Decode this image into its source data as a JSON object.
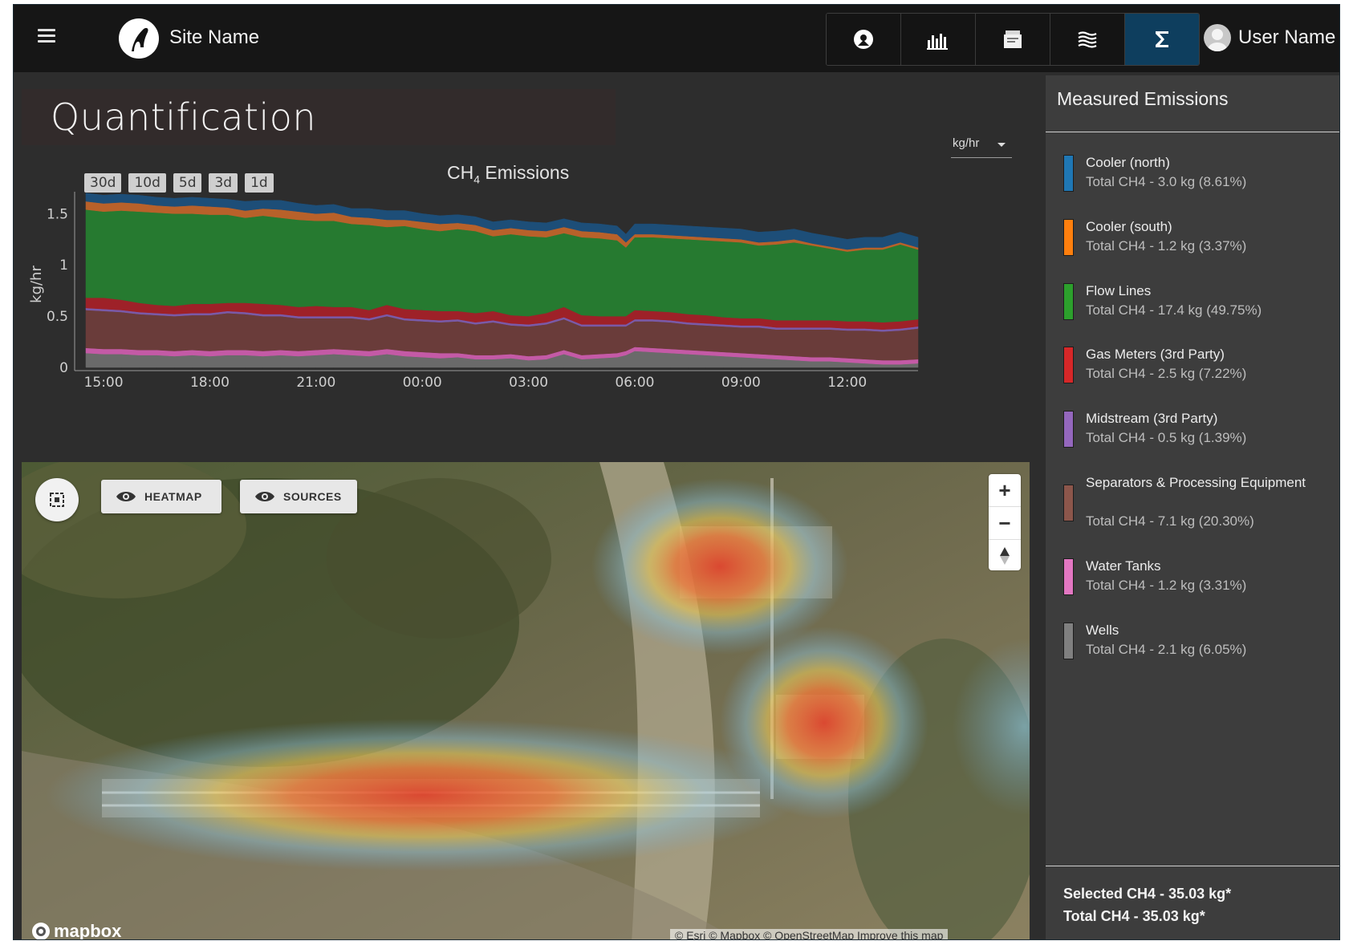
{
  "header": {
    "site_name": "Site Name",
    "user_name": "User Name",
    "nav_icons": [
      "map-pin-icon",
      "bar-chart-icon",
      "document-icon",
      "layers-icon",
      "sigma-icon"
    ],
    "active_nav": "sigma-icon",
    "colors": {
      "bar": "#161616",
      "active": "#0e3e5e"
    }
  },
  "page": {
    "title": "Quantification",
    "unit_select": "kg/hr",
    "range_buttons": [
      "30d",
      "10d",
      "5d",
      "3d",
      "1d"
    ]
  },
  "chart_data": {
    "type": "area",
    "stacked": true,
    "title": "CH4 Emissions",
    "title_sub": "4",
    "ylabel": "kg/hr",
    "xlabel": "",
    "ylim": [
      0,
      1.62
    ],
    "yticks": [
      0,
      0.5,
      1,
      1.5
    ],
    "ytick_labels": [
      "0",
      "0.5",
      "1",
      "1.5"
    ],
    "xticks": [
      15.0,
      18.0,
      21.0,
      24.0,
      27.0,
      30.0,
      33.0,
      36.0
    ],
    "xtick_labels": [
      "15:00",
      "18:00",
      "21:00",
      "00:00",
      "03:00",
      "06:00",
      "09:00",
      "12:00"
    ],
    "xlim": [
      14.5,
      38.0
    ],
    "x": [
      14.5,
      15,
      15.5,
      16,
      16.5,
      17,
      17.5,
      18,
      18.5,
      19,
      19.5,
      20,
      20.5,
      21,
      21.5,
      22,
      22.5,
      23,
      23.5,
      24,
      24.5,
      25,
      25.5,
      26,
      26.5,
      27,
      27.5,
      28,
      28.5,
      29,
      29.5,
      29.75,
      30,
      30.5,
      31,
      31.5,
      32,
      32.5,
      33,
      33.5,
      34,
      34.5,
      35,
      35.5,
      36,
      36.5,
      37,
      37.5,
      38
    ],
    "series": [
      {
        "name": "Wells",
        "color": "#6a6a6a",
        "values": [
          0.14,
          0.13,
          0.13,
          0.12,
          0.12,
          0.11,
          0.12,
          0.11,
          0.12,
          0.12,
          0.11,
          0.12,
          0.11,
          0.12,
          0.13,
          0.12,
          0.11,
          0.13,
          0.11,
          0.1,
          0.09,
          0.1,
          0.08,
          0.08,
          0.09,
          0.07,
          0.08,
          0.13,
          0.08,
          0.09,
          0.1,
          0.12,
          0.16,
          0.15,
          0.14,
          0.13,
          0.12,
          0.11,
          0.1,
          0.09,
          0.08,
          0.07,
          0.06,
          0.06,
          0.05,
          0.04,
          0.03,
          0.03,
          0.04
        ]
      },
      {
        "name": "Water Tanks",
        "color": "#c45aa6",
        "values": [
          0.05,
          0.05,
          0.05,
          0.05,
          0.05,
          0.05,
          0.05,
          0.05,
          0.05,
          0.05,
          0.05,
          0.05,
          0.05,
          0.05,
          0.05,
          0.05,
          0.05,
          0.05,
          0.05,
          0.05,
          0.05,
          0.04,
          0.04,
          0.04,
          0.04,
          0.04,
          0.04,
          0.04,
          0.04,
          0.04,
          0.04,
          0.04,
          0.04,
          0.04,
          0.04,
          0.04,
          0.04,
          0.04,
          0.04,
          0.04,
          0.04,
          0.04,
          0.04,
          0.04,
          0.04,
          0.04,
          0.04,
          0.04,
          0.04
        ]
      },
      {
        "name": "Separators & Processing Equipment",
        "color": "#6a3c3a",
        "values": [
          0.37,
          0.37,
          0.36,
          0.35,
          0.34,
          0.34,
          0.34,
          0.35,
          0.36,
          0.35,
          0.34,
          0.33,
          0.32,
          0.31,
          0.3,
          0.31,
          0.3,
          0.32,
          0.3,
          0.3,
          0.3,
          0.31,
          0.3,
          0.32,
          0.28,
          0.29,
          0.3,
          0.3,
          0.28,
          0.27,
          0.26,
          0.24,
          0.25,
          0.26,
          0.26,
          0.25,
          0.25,
          0.25,
          0.25,
          0.26,
          0.25,
          0.26,
          0.27,
          0.27,
          0.27,
          0.28,
          0.28,
          0.29,
          0.3
        ]
      },
      {
        "name": "Midstream (3rd Party)",
        "color": "#7a5aa8",
        "values": [
          0.02,
          0.02,
          0.02,
          0.02,
          0.02,
          0.02,
          0.02,
          0.02,
          0.02,
          0.02,
          0.02,
          0.02,
          0.02,
          0.02,
          0.02,
          0.02,
          0.02,
          0.02,
          0.02,
          0.02,
          0.02,
          0.02,
          0.02,
          0.02,
          0.02,
          0.02,
          0.02,
          0.02,
          0.02,
          0.02,
          0.02,
          0.02,
          0.02,
          0.02,
          0.02,
          0.02,
          0.02,
          0.02,
          0.02,
          0.02,
          0.02,
          0.02,
          0.02,
          0.02,
          0.02,
          0.02,
          0.02,
          0.02,
          0.02
        ]
      },
      {
        "name": "Gas Meters (3rd Party)",
        "color": "#9e2128",
        "values": [
          0.1,
          0.11,
          0.1,
          0.09,
          0.08,
          0.08,
          0.09,
          0.09,
          0.08,
          0.09,
          0.1,
          0.09,
          0.09,
          0.1,
          0.09,
          0.09,
          0.08,
          0.09,
          0.09,
          0.09,
          0.09,
          0.08,
          0.09,
          0.09,
          0.08,
          0.08,
          0.09,
          0.1,
          0.09,
          0.08,
          0.08,
          0.08,
          0.09,
          0.08,
          0.08,
          0.08,
          0.08,
          0.07,
          0.07,
          0.07,
          0.07,
          0.07,
          0.07,
          0.07,
          0.07,
          0.07,
          0.07,
          0.07,
          0.07
        ]
      },
      {
        "name": "Flow Lines",
        "color": "#267a30",
        "values": [
          0.86,
          0.84,
          0.87,
          0.89,
          0.9,
          0.9,
          0.88,
          0.87,
          0.86,
          0.83,
          0.86,
          0.85,
          0.85,
          0.83,
          0.84,
          0.81,
          0.83,
          0.76,
          0.81,
          0.79,
          0.78,
          0.8,
          0.8,
          0.73,
          0.79,
          0.78,
          0.74,
          0.72,
          0.76,
          0.76,
          0.74,
          0.67,
          0.71,
          0.72,
          0.72,
          0.73,
          0.73,
          0.74,
          0.74,
          0.71,
          0.74,
          0.76,
          0.73,
          0.7,
          0.68,
          0.7,
          0.71,
          0.75,
          0.68
        ]
      },
      {
        "name": "Cooler (south)",
        "color": "#b8612a",
        "values": [
          0.08,
          0.08,
          0.08,
          0.08,
          0.07,
          0.07,
          0.08,
          0.08,
          0.07,
          0.07,
          0.07,
          0.08,
          0.08,
          0.07,
          0.08,
          0.07,
          0.07,
          0.07,
          0.06,
          0.07,
          0.07,
          0.06,
          0.06,
          0.06,
          0.06,
          0.06,
          0.06,
          0.06,
          0.06,
          0.06,
          0.06,
          0.05,
          0.03,
          0.03,
          0.03,
          0.03,
          0.03,
          0.03,
          0.03,
          0.03,
          0.03,
          0.03,
          0.02,
          0.02,
          0.02,
          0.02,
          0.02,
          0.02,
          0.02
        ]
      },
      {
        "name": "Cooler (north)",
        "color": "#1d4e78",
        "values": [
          0.08,
          0.08,
          0.08,
          0.08,
          0.08,
          0.08,
          0.08,
          0.08,
          0.08,
          0.09,
          0.08,
          0.09,
          0.08,
          0.08,
          0.08,
          0.08,
          0.09,
          0.09,
          0.09,
          0.08,
          0.08,
          0.08,
          0.08,
          0.08,
          0.08,
          0.08,
          0.08,
          0.08,
          0.08,
          0.08,
          0.08,
          0.08,
          0.1,
          0.1,
          0.1,
          0.1,
          0.1,
          0.1,
          0.1,
          0.1,
          0.1,
          0.1,
          0.1,
          0.1,
          0.1,
          0.1,
          0.1,
          0.1,
          0.1
        ]
      }
    ]
  },
  "map": {
    "heatmap_label": "HEATMAP",
    "sources_label": "SOURCES",
    "zoom_in": "+",
    "zoom_out": "−",
    "mapbox_logo": "mapbox",
    "attribution": "© Esri  © Mapbox © OpenStreetMap  Improve this map"
  },
  "panel": {
    "title": "Measured Emissions",
    "items": [
      {
        "name": "Cooler (north)",
        "total": "Total CH4 - 3.0 kg (8.61%)",
        "color": "#1f77b4"
      },
      {
        "name": "Cooler (south)",
        "total": "Total CH4 - 1.2 kg (3.37%)",
        "color": "#ff7f0e"
      },
      {
        "name": "Flow Lines",
        "total": "Total CH4 - 17.4 kg (49.75%)",
        "color": "#2ca02c"
      },
      {
        "name": "Gas Meters (3rd Party)",
        "total": "Total CH4 - 2.5 kg (7.22%)",
        "color": "#d62728"
      },
      {
        "name": "Midstream (3rd Party)",
        "total": "Total CH4 - 0.5 kg (1.39%)",
        "color": "#9467bd"
      },
      {
        "name": "Separators & Processing Equipment",
        "total": "Total CH4 - 7.1 kg (20.30%)",
        "color": "#8c564b"
      },
      {
        "name": "Water Tanks",
        "total": "Total CH4 - 1.2 kg (3.31%)",
        "color": "#e377c2"
      },
      {
        "name": "Wells",
        "total": "Total CH4 - 2.1 kg (6.05%)",
        "color": "#7f7f7f"
      }
    ],
    "selected": "Selected CH4 - 35.03 kg*",
    "total": "Total CH4 - 35.03 kg*"
  }
}
